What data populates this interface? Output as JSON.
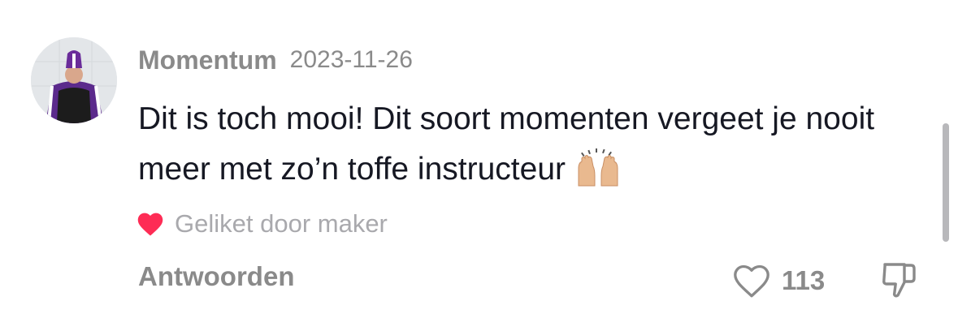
{
  "comment": {
    "username": "Momentum",
    "date": "2023-11-26",
    "text": "Dit is toch mooi! Dit soort momenten vergeet je nooit meer met zo’n toffe instructeur",
    "emoji": "raising-hands-emoji",
    "liked_by_creator_label": "Geliket door maker",
    "reply_label": "Antwoorden",
    "like_count": "113"
  },
  "icons": {
    "creator_heart": "heart-filled-icon",
    "like": "heart-outline-icon",
    "dislike": "thumbs-down-icon"
  },
  "colors": {
    "heart": "#fe2c55",
    "text": "#161823",
    "muted": "#8a8a8a"
  }
}
